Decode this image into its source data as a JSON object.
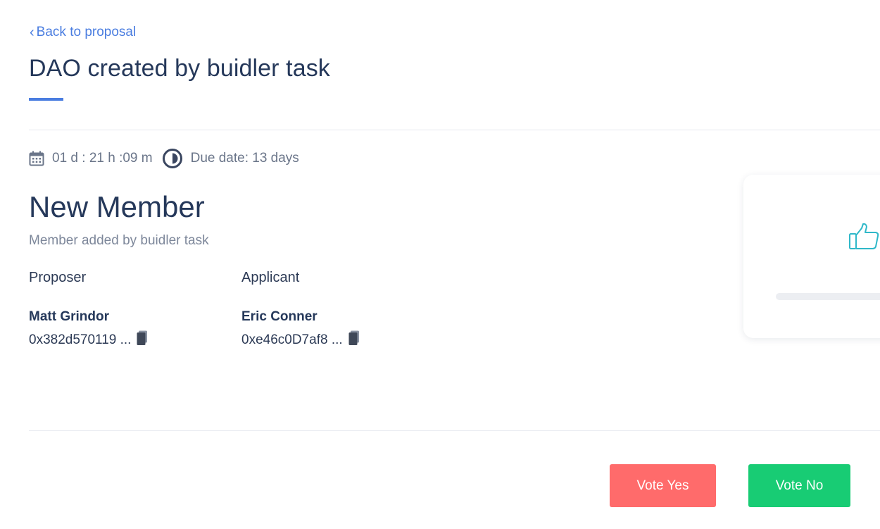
{
  "nav": {
    "back_label": "Back to proposal"
  },
  "header": {
    "title": "DAO created by buidler task"
  },
  "meta": {
    "countdown": "01 d : 21 h :09 m",
    "due": "Due date: 13 days"
  },
  "proposal": {
    "title": "New Member",
    "subtitle": "Member added by buidler task",
    "proposer": {
      "label": "Proposer",
      "name": "Matt Grindor",
      "address": "0x382d570119 ..."
    },
    "applicant": {
      "label": "Applicant",
      "name": "Eric Conner",
      "address": "0xe46c0D7af8 ..."
    }
  },
  "actions": {
    "vote_yes": "Vote Yes",
    "vote_no": "Vote No"
  },
  "colors": {
    "accent": "#4a7de0",
    "vote_yes": "#ff6b6b",
    "vote_no": "#18cc74",
    "thumb": "#2fb8c9"
  },
  "icons": {
    "calendar": "calendar-icon",
    "clock": "clock-icon",
    "copy": "copy-icon",
    "thumb": "thumbs-up-icon"
  }
}
